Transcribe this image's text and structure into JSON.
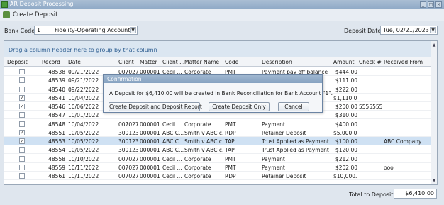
{
  "window": {
    "title": "AR Deposit Processing"
  },
  "toolbar": {
    "create_deposit_label": "Create Deposit"
  },
  "filters": {
    "bank_code_label": "Bank Code",
    "bank_code_value": "1",
    "bank_account_value": "Fidelity-Operating Account",
    "deposit_date_label": "Deposit Date",
    "deposit_date_value": "Tue, 02/21/2023"
  },
  "grid": {
    "group_hint": "Drag a column header here to group by that column",
    "columns": [
      "Deposit",
      "Record",
      "Date",
      "Client",
      "Matter",
      "Client ...",
      "Matter Name",
      "Code",
      "Description",
      "Amount",
      "Check #",
      "Received From"
    ],
    "rows": [
      {
        "checked": false,
        "record": "48538",
        "date": "09/21/2022",
        "client": "007027",
        "matter": "000001",
        "client_name": "Cecil ...",
        "matter_name": "Corporate",
        "code": "PMT",
        "description": "Payment pay off balance",
        "amount": "$444.00",
        "check": "",
        "received_from": ""
      },
      {
        "checked": false,
        "record": "48539",
        "date": "09/21/2022",
        "client": "",
        "matter": "",
        "client_name": "",
        "matter_name": "",
        "code": "",
        "description": "",
        "amount": "$111.00",
        "check": "",
        "received_from": ""
      },
      {
        "checked": false,
        "record": "48540",
        "date": "09/22/2022",
        "client": "",
        "matter": "",
        "client_name": "",
        "matter_name": "",
        "code": "",
        "description": "",
        "amount": "$222.00",
        "check": "",
        "received_from": ""
      },
      {
        "checked": true,
        "record": "48541",
        "date": "10/04/2022",
        "client": "",
        "matter": "",
        "client_name": "",
        "matter_name": "",
        "code": "",
        "description": "",
        "amount": "$1,110.0...",
        "check": "",
        "received_from": ""
      },
      {
        "checked": true,
        "record": "48546",
        "date": "10/06/2022",
        "client": "",
        "matter": "",
        "client_name": "",
        "matter_name": "",
        "code": "",
        "description": "",
        "amount": "$200.00",
        "check": "5555555",
        "received_from": ""
      },
      {
        "checked": false,
        "record": "48547",
        "date": "10/01/2022",
        "client": "",
        "matter": "",
        "client_name": "",
        "matter_name": "",
        "code": "",
        "description": "",
        "amount": "$310.00",
        "check": "",
        "received_from": ""
      },
      {
        "checked": false,
        "record": "48548",
        "date": "10/04/2022",
        "client": "007027",
        "matter": "000001",
        "client_name": "Cecil ...",
        "matter_name": "Corporate",
        "code": "PMT",
        "description": "Payment",
        "amount": "$400.00",
        "check": "",
        "received_from": ""
      },
      {
        "checked": true,
        "record": "48551",
        "date": "10/05/2022",
        "client": "300123",
        "matter": "000001",
        "client_name": "ABC C...",
        "matter_name": "Smith v ABC c...",
        "code": "RDP",
        "description": "Retainer Deposit",
        "amount": "$5,000.0...",
        "check": "",
        "received_from": ""
      },
      {
        "checked": true,
        "record": "48553",
        "date": "10/05/2022",
        "client": "300123",
        "matter": "000001",
        "client_name": "ABC C...",
        "matter_name": "Smith v ABC c...",
        "code": "TAP",
        "description": "Trust Applied as Payment",
        "amount": "$100.00",
        "check": "",
        "received_from": "ABC Company"
      },
      {
        "checked": false,
        "record": "48554",
        "date": "10/05/2022",
        "client": "300123",
        "matter": "000001",
        "client_name": "ABC C...",
        "matter_name": "Smith v ABC c...",
        "code": "TAP",
        "description": "Trust Applied as Payment",
        "amount": "$120.00",
        "check": "",
        "received_from": ""
      },
      {
        "checked": false,
        "record": "48558",
        "date": "10/10/2022",
        "client": "007027",
        "matter": "000001",
        "client_name": "Cecil ...",
        "matter_name": "Corporate",
        "code": "PMT",
        "description": "Payment",
        "amount": "$212.00",
        "check": "",
        "received_from": ""
      },
      {
        "checked": false,
        "record": "48559",
        "date": "10/11/2022",
        "client": "007027",
        "matter": "000001",
        "client_name": "Cecil ...",
        "matter_name": "Corporate",
        "code": "PMT",
        "description": "Payment",
        "amount": "$202.00",
        "check": "",
        "received_from": "ooo"
      },
      {
        "checked": false,
        "record": "48561",
        "date": "10/11/2022",
        "client": "007027",
        "matter": "000001",
        "client_name": "Cecil ...",
        "matter_name": "Corporate",
        "code": "RDP",
        "description": "Retainer Deposit",
        "amount": "$10,000....",
        "check": "",
        "received_from": ""
      }
    ]
  },
  "dialog": {
    "title": "Confirmation",
    "message": "A Deposit for $6,410.00 will be created in Bank Reconciliation for Bank Account \"1\".",
    "btn_report": "Create Deposit and Deposit Report",
    "btn_only": "Create Deposit Only",
    "btn_cancel": "Cancel"
  },
  "footer": {
    "total_label": "Total to Deposit",
    "total_value": "$6,410.00"
  },
  "icons": {
    "check": "✓",
    "dropdown": "chevron-down-icon"
  }
}
